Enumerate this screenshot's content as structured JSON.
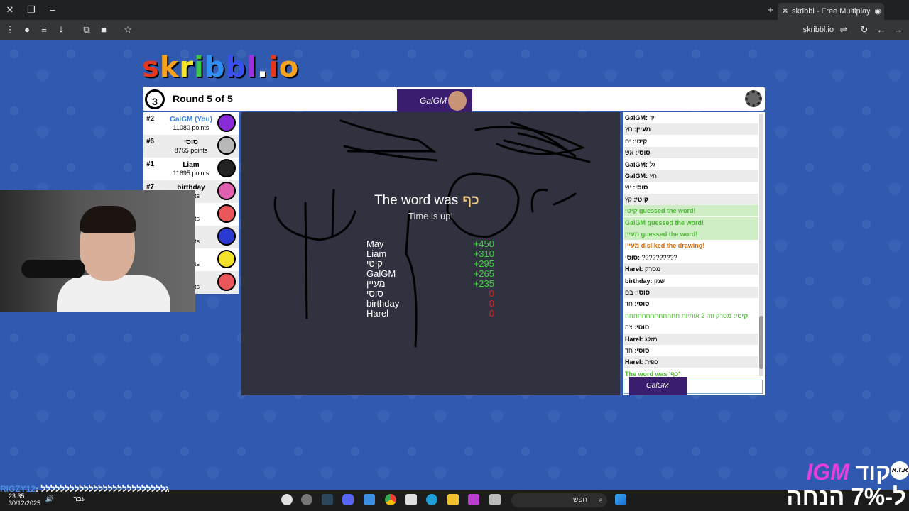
{
  "browser": {
    "tab_title": "skribbl - Free Multiplayer D",
    "url": "skribbl.io",
    "icons": [
      "close-icon",
      "restore-icon",
      "minimize-icon",
      "plus-icon",
      "menu-icon",
      "profile-icon",
      "extension-icon",
      "download-icon",
      "puzzle-icon",
      "bookmark-star-icon",
      "reload-icon",
      "back-icon",
      "forward-icon"
    ]
  },
  "game": {
    "logo_letters": [
      "s",
      "k",
      "r",
      "i",
      "b",
      "b",
      "l",
      ".",
      "i",
      "o"
    ],
    "logo_colors": [
      "#e8361d",
      "#f6a21c",
      "#f6e12b",
      "#3cc44a",
      "#2e8ef2",
      "#3a4ff0",
      "#9c31e0",
      "#ffffff",
      "#e8361d",
      "#f6a21c"
    ],
    "timer": "3",
    "round": "Round 5 of 5",
    "banner": "GalGM",
    "players": [
      {
        "rank": "#2",
        "name": "GalGM (You)",
        "points": "11080 points",
        "color": "#8a2bd8",
        "you": true
      },
      {
        "rank": "#6",
        "name": "סוסי",
        "points": "8755 points",
        "color": "#b8b8b8"
      },
      {
        "rank": "#1",
        "name": "Liam",
        "points": "11695 points",
        "color": "#222222"
      },
      {
        "rank": "#7",
        "name": "birthday",
        "points": "points",
        "color": "#e060b0"
      },
      {
        "rank": "",
        "name": "",
        "points": "points",
        "color": "#e8585a"
      },
      {
        "rank": "",
        "name": "",
        "points": "points",
        "color": "#2a3ad0"
      },
      {
        "rank": "",
        "name": "",
        "points": "points",
        "color": "#f2e22a"
      },
      {
        "rank": "",
        "name": "el",
        "points": "points",
        "color": "#e8585a"
      }
    ],
    "word_prefix": "The word was",
    "word": "כף",
    "time_up": "Time is up!",
    "results": [
      {
        "name": "May",
        "score": "+450"
      },
      {
        "name": "Liam",
        "score": "+310"
      },
      {
        "name": "קיטי",
        "score": "+295"
      },
      {
        "name": "GalGM",
        "score": "+265"
      },
      {
        "name": "מעיין",
        "score": "+235"
      },
      {
        "name": "סוסי",
        "score": "0"
      },
      {
        "name": "birthday",
        "score": "0"
      },
      {
        "name": "Harel",
        "score": "0"
      }
    ],
    "chat": [
      {
        "user": "GalGM:",
        "text": "יד",
        "type": "n"
      },
      {
        "user": "מעיין:",
        "text": "חץ",
        "type": "n"
      },
      {
        "user": "קיטי:",
        "text": "ים",
        "type": "n"
      },
      {
        "user": "סוסי:",
        "text": "אש",
        "type": "n"
      },
      {
        "user": "GalGM:",
        "text": "גל",
        "type": "n"
      },
      {
        "user": "GalGM:",
        "text": "חץ",
        "type": "n"
      },
      {
        "user": "סוסי:",
        "text": "יש",
        "type": "n"
      },
      {
        "user": "קיטי:",
        "text": "קץ",
        "type": "n"
      },
      {
        "user": "קיטי",
        "text": "guessed the word!",
        "type": "g"
      },
      {
        "user": "GalGM",
        "text": "guessed the word!",
        "type": "g"
      },
      {
        "user": "מעיין",
        "text": "guessed the word!",
        "type": "g"
      },
      {
        "user": "מעיין",
        "text": "disliked the drawing!",
        "type": "o"
      },
      {
        "user": "סוסי:",
        "text": "??????????",
        "type": "n"
      },
      {
        "user": "Harel:",
        "text": "מסרק",
        "type": "n"
      },
      {
        "user": "birthday:",
        "text": "שמן",
        "type": "n"
      },
      {
        "user": "סוסי:",
        "text": "בם",
        "type": "n"
      },
      {
        "user": "סוסי:",
        "text": "חד",
        "type": "n"
      },
      {
        "user": "קיטי:",
        "text": "מסרק וזה 2 אותיות חחחחחחחחחחחחח",
        "type": "e"
      },
      {
        "user": "סוסי:",
        "text": "צה",
        "type": "n"
      },
      {
        "user": "Harel:",
        "text": "מזלג",
        "type": "n"
      },
      {
        "user": "סוסי:",
        "text": "חד",
        "type": "n"
      },
      {
        "user": "Harel:",
        "text": "כפית",
        "type": "n"
      },
      {
        "user": "",
        "text": "The word was 'כף'",
        "type": "end"
      }
    ]
  },
  "overlay": {
    "ticker_user": "RIGZY12",
    "ticker_text": ": גלללללללללללללללללללללללללל",
    "time": "23:35",
    "date": "30/12/2025",
    "lang": "עבר",
    "search_text": "חפש",
    "promo_line1_prefix": "קוד",
    "promo_code": "IGM",
    "promo_line2": "ל-7% הנחה",
    "promo_badge": "א.ז.א"
  }
}
